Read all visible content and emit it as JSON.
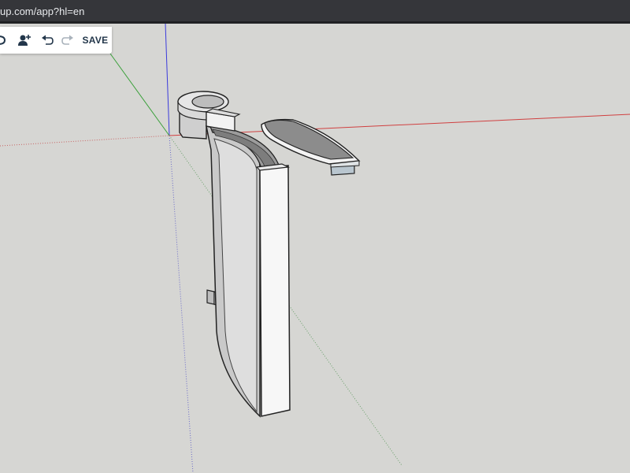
{
  "browser": {
    "url_visible": "up.com/app?hl=en"
  },
  "toolbar": {
    "items": [
      {
        "name": "truncated-icon",
        "kind": "icon",
        "interactable": true
      },
      {
        "name": "add-collaborator-icon",
        "kind": "icon",
        "interactable": true
      },
      {
        "name": "undo-icon",
        "kind": "icon",
        "interactable": true
      },
      {
        "name": "redo-icon",
        "kind": "icon",
        "interactable": true,
        "disabled": true
      }
    ],
    "save_label": "SAVE"
  },
  "colors": {
    "axis_red": "#d04040",
    "axis_green": "#3aa03a",
    "axis_blue": "#3a3adc",
    "toolbar_text": "#22364a",
    "viewport_bg": "#d6d6d3",
    "browser_bar": "#35363a"
  },
  "scene": {
    "objects": [
      "curved-wall-part",
      "handle-ring-part",
      "lid-part"
    ]
  }
}
